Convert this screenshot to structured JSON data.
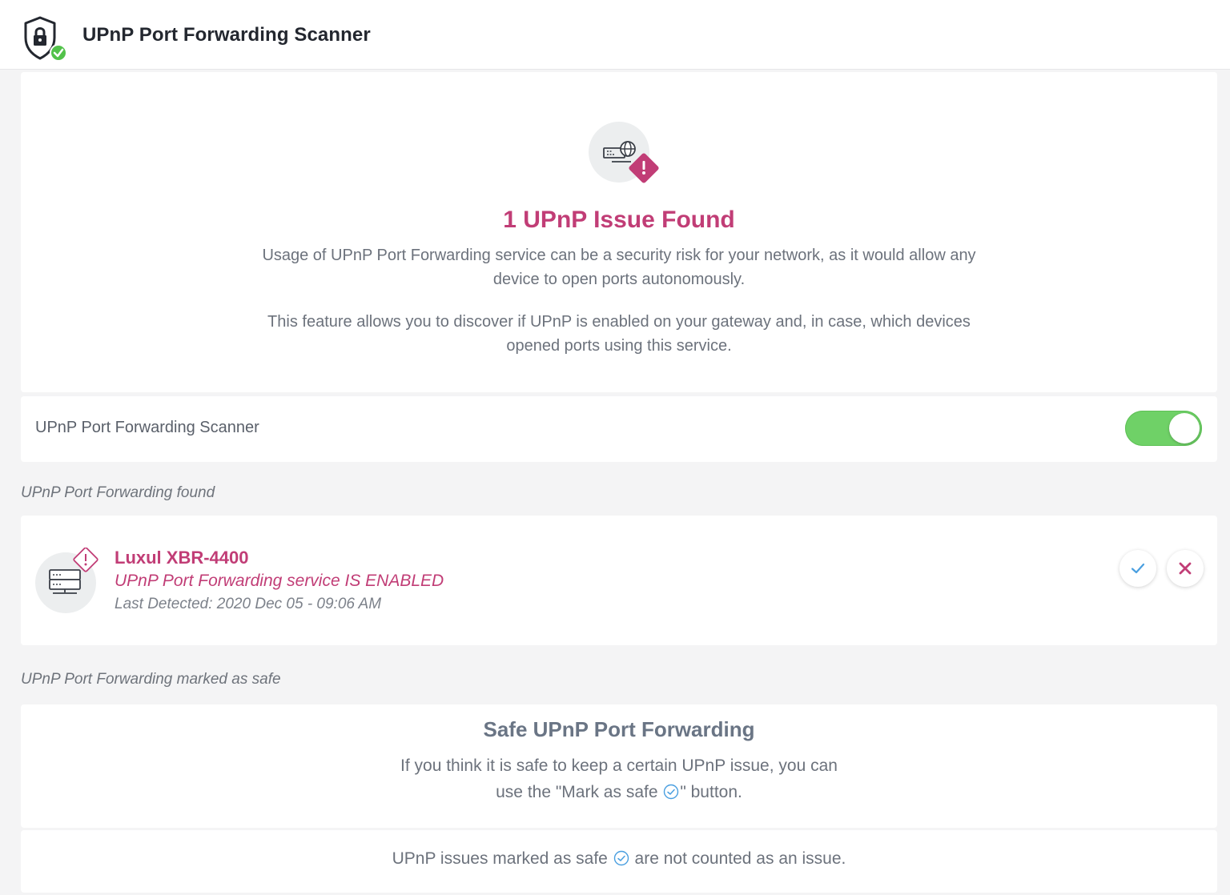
{
  "app": {
    "title": "UPnP Port Forwarding Scanner",
    "logo_icon": "shield-lock-icon"
  },
  "hero": {
    "icon": "network-gateway-warning-icon",
    "title": "1 UPnP Issue Found",
    "paragraph1": "Usage of UPnP Port Forwarding service can be a security risk for your network, as it would allow any device to open ports autonomously.",
    "paragraph2": "This feature allows you to discover if UPnP is enabled on your gateway and, in case, which devices opened ports using this service."
  },
  "scanner_toggle": {
    "label": "UPnP Port Forwarding Scanner",
    "enabled": true
  },
  "found_section": {
    "label": "UPnP Port Forwarding found",
    "items": [
      {
        "device_name": "Luxul XBR-4400",
        "status": "UPnP Port Forwarding service IS ENABLED",
        "last_detected": "Last Detected: 2020 Dec 05 - 09:06 AM",
        "icon": "router-warning-icon"
      }
    ]
  },
  "safe_section": {
    "label": "UPnP Port Forwarding marked as safe",
    "title": "Safe UPnP Port Forwarding",
    "text_line1": "If you think it is safe to keep a certain UPnP issue, you can",
    "text_line2_before": "use the \"Mark as safe ",
    "text_line2_after": "\" button.",
    "note_before": "UPnP issues marked as safe ",
    "note_after": " are not counted as an issue."
  },
  "colors": {
    "accent": "#c13d76",
    "toggle_on": "#6fd167",
    "safe_check": "#4a9fe0",
    "background": "#f4f4f5"
  }
}
